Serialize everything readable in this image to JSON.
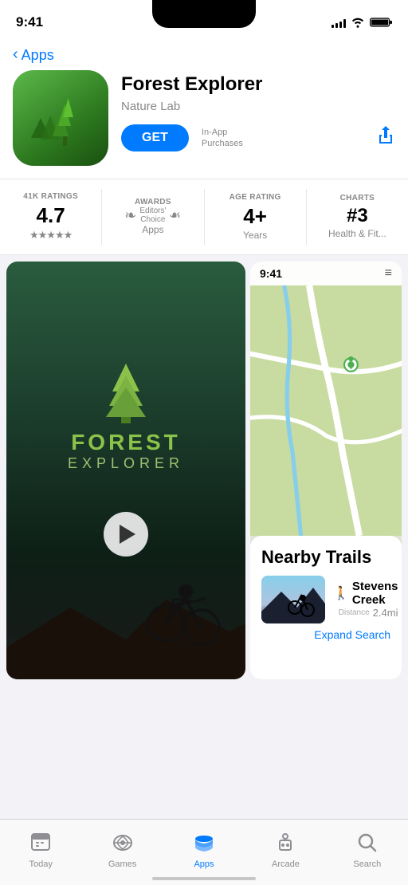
{
  "statusBar": {
    "time": "9:41",
    "signalBars": [
      4,
      6,
      8,
      10,
      12
    ],
    "batteryLevel": 100
  },
  "backNav": {
    "label": "Apps",
    "chevron": "‹"
  },
  "app": {
    "name": "Forest Explorer",
    "developer": "Nature Lab",
    "getButtonLabel": "GET",
    "iapLine1": "In-App",
    "iapLine2": "Purchases"
  },
  "stats": [
    {
      "label": "41K RATINGS",
      "value": "4.7",
      "sub": "★★★★★"
    },
    {
      "label": "AWARDS",
      "value": "",
      "sub": "Apps",
      "isAward": true,
      "awardTitle": "Editors'",
      "awardTitleLine2": "Choice"
    },
    {
      "label": "AGE RATING",
      "value": "4+",
      "sub": "Years"
    },
    {
      "label": "CHARTS",
      "value": "#3",
      "sub": "Health & Fit..."
    }
  ],
  "screenshot1": {
    "treeIcon": "🌲",
    "title": "FOREST",
    "subtitle": "EXPLORER"
  },
  "screenshot2": {
    "time": "9:41",
    "cardTitle": "Nearby Trails",
    "trail": {
      "name": "Stevens Creek",
      "distance": "2.4mi",
      "distanceLabel": "Distance"
    },
    "expandSearch": "Expand Search"
  },
  "tabBar": {
    "items": [
      {
        "id": "today",
        "label": "Today",
        "icon": "📋",
        "active": false
      },
      {
        "id": "games",
        "label": "Games",
        "icon": "🚀",
        "active": false
      },
      {
        "id": "apps",
        "label": "Apps",
        "icon": "📚",
        "active": true
      },
      {
        "id": "arcade",
        "label": "Arcade",
        "icon": "🕹️",
        "active": false
      },
      {
        "id": "search",
        "label": "Search",
        "icon": "🔍",
        "active": false
      }
    ]
  }
}
